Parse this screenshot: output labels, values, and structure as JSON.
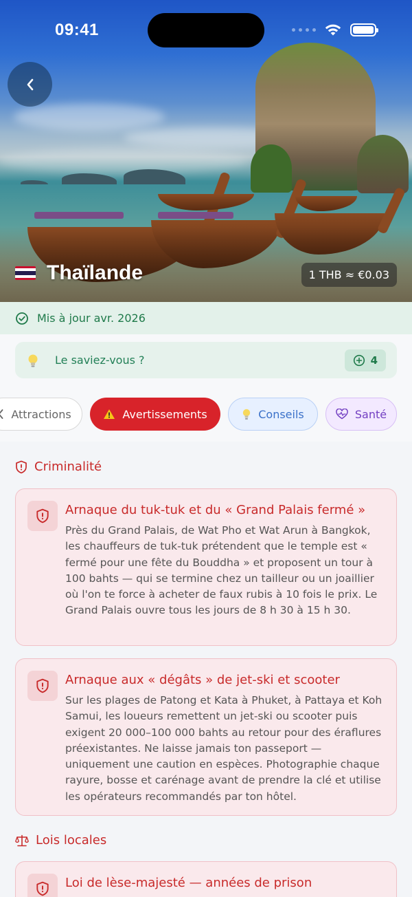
{
  "status_bar": {
    "time": "09:41"
  },
  "header": {
    "back_icon": "chevron-left-icon",
    "flag": "thailand-flag",
    "country_name": "Thaïlande",
    "exchange_rate": "1 THB ≈ €0.03"
  },
  "updated": {
    "icon": "check-circle-icon",
    "text": "Mis à jour avr. 2026"
  },
  "did_you_know": {
    "icon": "lightbulb-icon",
    "label": "Le saviez-vous ?",
    "badge_icon": "plus-circle-icon",
    "count": "4"
  },
  "tabs": [
    {
      "label": "Attractions",
      "icon": "chevron-left-icon"
    },
    {
      "label": "Avertissements",
      "icon": "warning-icon",
      "active": true
    },
    {
      "label": "Conseils",
      "icon": "lightbulb-icon"
    },
    {
      "label": "Santé",
      "icon": "heart-pulse-icon"
    }
  ],
  "sections": [
    {
      "title": "Criminalité",
      "icon": "shield-alert-icon",
      "cards": [
        {
          "title": "Arnaque du tuk-tuk et du « Grand Palais fermé »",
          "body": "Près du Grand Palais, de Wat Pho et Wat Arun à Bangkok, les chauffeurs de tuk-tuk prétendent que le temple est « fermé pour une fête du Bouddha » et proposent un tour à 100 bahts — qui se termine chez un tailleur ou un joaillier où l'on te force à acheter de faux rubis à 10 fois le prix. Le Grand Palais ouvre tous les jours de 8 h 30 à 15 h 30."
        },
        {
          "title": "Arnaque aux « dégâts » de jet-ski et scooter",
          "body": "Sur les plages de Patong et Kata à Phuket, à Pattaya et Koh Samui, les loueurs remettent un jet-ski ou scooter puis exigent 20 000–100 000 bahts au retour pour des éraflures préexistantes. Ne laisse jamais ton passeport — uniquement une caution en espèces. Photographie chaque rayure, bosse et carénage avant de prendre la clé et utilise les opérateurs recommandés par ton hôtel."
        }
      ]
    },
    {
      "title": "Lois locales",
      "icon": "scale-icon",
      "cards": [
        {
          "title": "Loi de lèse-majesté — années de prison",
          "body": ""
        }
      ]
    }
  ],
  "colors": {
    "accent_red": "#d8232a",
    "green": "#1f7a4a",
    "blue": "#3b71c9",
    "purple": "#7340c2"
  }
}
